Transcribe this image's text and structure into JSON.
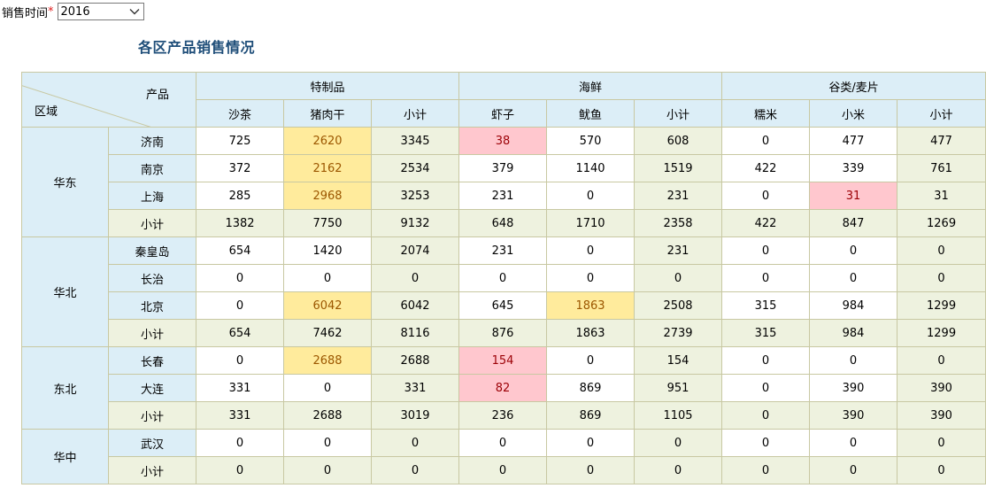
{
  "filter": {
    "label": "销售时间",
    "required_mark": "*",
    "value": "2016"
  },
  "title": "各区产品销售情况",
  "header": {
    "corner_product": "产品",
    "corner_region": "区域",
    "groups": [
      "特制品",
      "海鲜",
      "谷类/麦片"
    ],
    "columns": [
      "沙茶",
      "猪肉干",
      "小计",
      "虾子",
      "鱿鱼",
      "小计",
      "糯米",
      "小米",
      "小计"
    ]
  },
  "regions": [
    {
      "name": "华东",
      "rows": [
        {
          "city": "济南",
          "values": [
            "725",
            "2620",
            "3345",
            "38",
            "570",
            "608",
            "0",
            "477",
            "477"
          ]
        },
        {
          "city": "南京",
          "values": [
            "372",
            "2162",
            "2534",
            "379",
            "1140",
            "1519",
            "422",
            "339",
            "761"
          ]
        },
        {
          "city": "上海",
          "values": [
            "285",
            "2968",
            "3253",
            "231",
            "0",
            "231",
            "0",
            "31",
            "31"
          ]
        },
        {
          "city": "小计",
          "values": [
            "1382",
            "7750",
            "9132",
            "648",
            "1710",
            "2358",
            "422",
            "847",
            "1269"
          ]
        }
      ]
    },
    {
      "name": "华北",
      "rows": [
        {
          "city": "秦皇岛",
          "values": [
            "654",
            "1420",
            "2074",
            "231",
            "0",
            "231",
            "0",
            "0",
            "0"
          ]
        },
        {
          "city": "长治",
          "values": [
            "0",
            "0",
            "0",
            "0",
            "0",
            "0",
            "0",
            "0",
            "0"
          ]
        },
        {
          "city": "北京",
          "values": [
            "0",
            "6042",
            "6042",
            "645",
            "1863",
            "2508",
            "315",
            "984",
            "1299"
          ]
        },
        {
          "city": "小计",
          "values": [
            "654",
            "7462",
            "8116",
            "876",
            "1863",
            "2739",
            "315",
            "984",
            "1299"
          ]
        }
      ]
    },
    {
      "name": "东北",
      "rows": [
        {
          "city": "长春",
          "values": [
            "0",
            "2688",
            "2688",
            "154",
            "0",
            "154",
            "0",
            "0",
            "0"
          ]
        },
        {
          "city": "大连",
          "values": [
            "331",
            "0",
            "331",
            "82",
            "869",
            "951",
            "0",
            "390",
            "390"
          ]
        },
        {
          "city": "小计",
          "values": [
            "331",
            "2688",
            "3019",
            "236",
            "869",
            "1105",
            "0",
            "390",
            "390"
          ]
        }
      ]
    },
    {
      "name": "华中",
      "rows": [
        {
          "city": "武汉",
          "values": [
            "0",
            "0",
            "0",
            "0",
            "0",
            "0",
            "0",
            "0",
            "0"
          ]
        },
        {
          "city": "小计",
          "values": [
            "0",
            "0",
            "0",
            "0",
            "0",
            "0",
            "0",
            "0",
            "0"
          ]
        }
      ]
    }
  ],
  "highlights": {
    "yellow_bg": "#ffeb9c",
    "red_bg": "#ffc7ce",
    "yellow_cells": [
      "0.0.1",
      "0.1.1",
      "0.2.1",
      "1.2.1",
      "1.2.4",
      "2.0.1"
    ],
    "red_cells": [
      "0.0.3",
      "0.2.7",
      "2.0.3",
      "2.1.3"
    ]
  }
}
